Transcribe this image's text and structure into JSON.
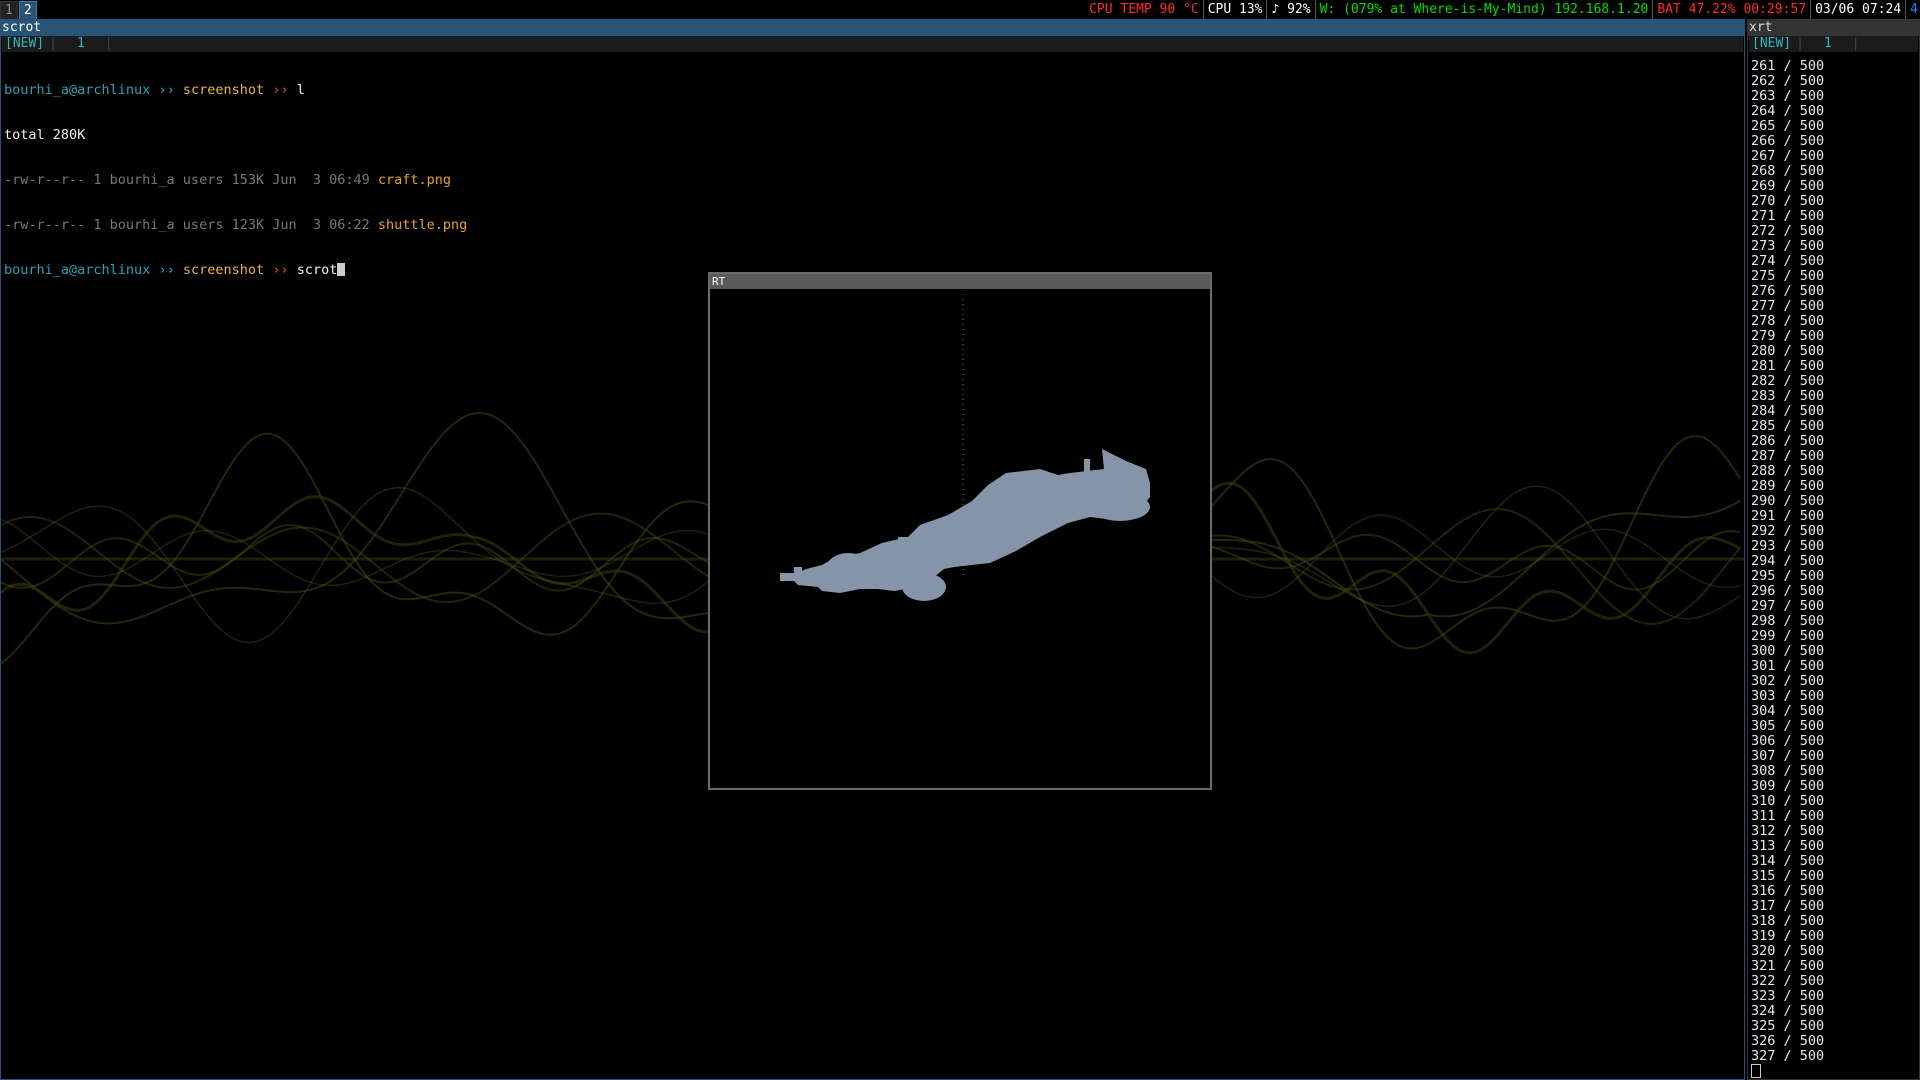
{
  "bar": {
    "workspaces": [
      {
        "label": "1",
        "active": false
      },
      {
        "label": "2",
        "active": true
      }
    ],
    "status": [
      {
        "text": "CPU TEMP 90 °C",
        "color": "#ff2a2a"
      },
      {
        "text": "CPU 13%",
        "color": "#ffffff"
      },
      {
        "text": "♪ 92%",
        "color": "#ffffff"
      },
      {
        "text": "W: (079% at Where-is-My-Mind) 192.168.1.20",
        "color": "#00dd00"
      },
      {
        "text": "BAT 47.22% 00:29:57",
        "color": "#ff2a2a"
      },
      {
        "text": "03/06 07:24",
        "color": "#ffffff"
      },
      {
        "text": "4",
        "color": "#2a7fff"
      }
    ]
  },
  "left_window": {
    "title": "scrot",
    "tab_new": "[NEW]",
    "tab_num": "1",
    "prompt_user": "bourhi_a@archlinux",
    "prompt_sep1": "››",
    "prompt_dir": "screenshot",
    "prompt_sep2": "››",
    "command1": "l",
    "total": "total 280K",
    "files": [
      {
        "meta": "-rw-r--r-- 1 bourhi_a users 153K Jun  3 06:49 ",
        "name": "craft.png"
      },
      {
        "meta": "-rw-r--r-- 1 bourhi_a users 123K Jun  3 06:22 ",
        "name": "shuttle.png"
      }
    ],
    "command2": "scrot"
  },
  "rt_window": {
    "title": "RT"
  },
  "right_window": {
    "title": "xrt",
    "tab_new": "[NEW]",
    "tab_num": "1",
    "progress_total": "500",
    "progress_lines": [
      "261",
      "262",
      "263",
      "264",
      "265",
      "266",
      "267",
      "268",
      "269",
      "270",
      "271",
      "272",
      "273",
      "274",
      "275",
      "276",
      "277",
      "278",
      "279",
      "280",
      "281",
      "282",
      "283",
      "284",
      "285",
      "286",
      "287",
      "288",
      "289",
      "290",
      "291",
      "292",
      "293",
      "294",
      "295",
      "296",
      "297",
      "298",
      "299",
      "300",
      "301",
      "302",
      "303",
      "304",
      "305",
      "306",
      "307",
      "308",
      "309",
      "310",
      "311",
      "312",
      "313",
      "314",
      "315",
      "316",
      "317",
      "318",
      "319",
      "320",
      "321",
      "322",
      "323",
      "324",
      "325",
      "326",
      "327"
    ]
  }
}
